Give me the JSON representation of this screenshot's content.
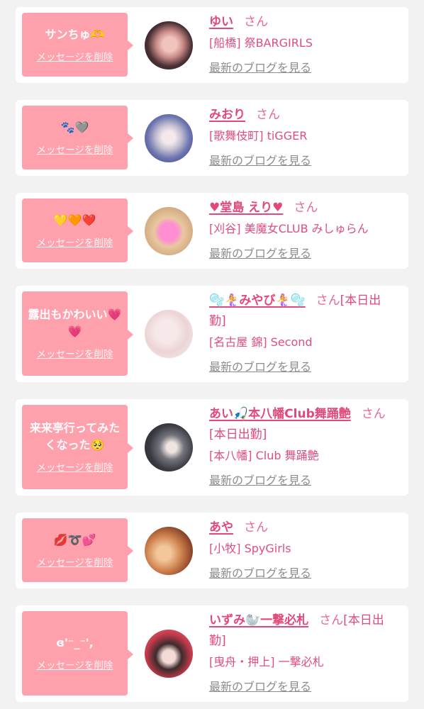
{
  "cards": [
    {
      "message": "サンちゅ🫶",
      "delete_label": "メッセージを削除",
      "name": "ゆい",
      "honorific": "さん",
      "shop": "[船橋] 祭BARGIRLS",
      "blog_label": "最新のブログを見る"
    },
    {
      "message": "🐾🩶",
      "delete_label": "メッセージを削除",
      "name": "みおり",
      "honorific": "さん",
      "shop": "[歌舞伎町] tiGGER",
      "blog_label": "最新のブログを見る"
    },
    {
      "message": "💛🧡❤️",
      "delete_label": "メッセージを削除",
      "name": "♥堂島 えり♥",
      "honorific": "さん",
      "shop": "[刈谷] 美魔女CLUB みしゅらん",
      "blog_label": "最新のブログを見る"
    },
    {
      "message": "露出もかわいい💗💗",
      "delete_label": "メッセージを削除",
      "name": "🫧🧜‍♀️みやび🧜‍♀️🫧",
      "honorific": "さん",
      "status": "[本日出勤]",
      "shop": "[名古屋 錦] Second",
      "blog_label": "最新のブログを見る"
    },
    {
      "message": "来来亭行ってみたくなった🥺",
      "delete_label": "メッセージを削除",
      "name": "あい🎣本八幡Club舞踊艶",
      "honorific": "さん",
      "status": "[本日出勤]",
      "shop": "[本八幡] Club 舞踊艶",
      "blog_label": "最新のブログを見る"
    },
    {
      "message": "💋➰💕",
      "delete_label": "メッセージを削除",
      "name": "あや",
      "honorific": "さん",
      "shop": "[小牧] SpyGirls",
      "blog_label": "最新のブログを見る"
    },
    {
      "message": "ɞ'⁻_⁻',",
      "delete_label": "メッセージを削除",
      "name": "いずみ🦭一撃必札",
      "honorific": "さん",
      "status": "[本日出勤]",
      "shop": "[曳舟・押上] 一撃必札",
      "blog_label": "最新のブログを見る"
    }
  ],
  "colors": {
    "page_background": "#f2f2f2",
    "bubble": "#ffa0ad",
    "name_pink": "#e2497a",
    "blog_gray": "#8c8c8c"
  }
}
